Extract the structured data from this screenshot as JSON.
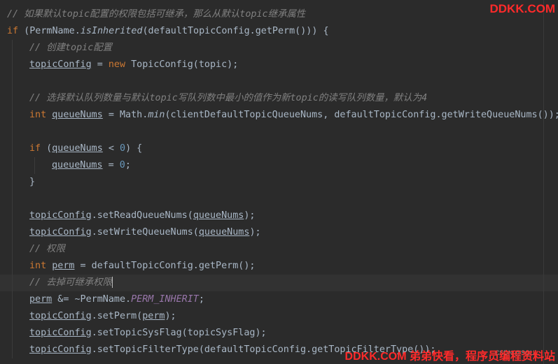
{
  "code": {
    "lines": [
      {
        "indent": 0,
        "tokens": [
          {
            "t": "// 如果默认topic配置的权限包括可继承，那么从默认topic继承属性",
            "c": "comment"
          }
        ]
      },
      {
        "indent": 0,
        "tokens": [
          {
            "t": "if",
            "c": "keyword"
          },
          {
            "t": " (PermName."
          },
          {
            "t": "isInherited",
            "c": "italic"
          },
          {
            "t": "(defaultTopicConfig.getPerm())) {"
          }
        ]
      },
      {
        "indent": 1,
        "tokens": [
          {
            "t": "// 创建topic配置",
            "c": "comment"
          }
        ]
      },
      {
        "indent": 1,
        "tokens": [
          {
            "t": "topicConfig",
            "c": "u"
          },
          {
            "t": " = "
          },
          {
            "t": "new",
            "c": "keyword"
          },
          {
            "t": " TopicConfig(topic);"
          }
        ]
      },
      {
        "indent": 1,
        "tokens": []
      },
      {
        "indent": 1,
        "tokens": [
          {
            "t": "// 选择默认队列数量与默认topic写队列数中最小的值作为新topic的读写队列数量，默认为4",
            "c": "comment"
          }
        ]
      },
      {
        "indent": 1,
        "tokens": [
          {
            "t": "int",
            "c": "keyword"
          },
          {
            "t": " "
          },
          {
            "t": "queueNums",
            "c": "u"
          },
          {
            "t": " = Math."
          },
          {
            "t": "min",
            "c": "italic"
          },
          {
            "t": "(clientDefaultTopicQueueNums, defaultTopicConfig.getWriteQueueNums());"
          }
        ]
      },
      {
        "indent": 1,
        "tokens": []
      },
      {
        "indent": 1,
        "tokens": [
          {
            "t": "if",
            "c": "keyword"
          },
          {
            "t": " ("
          },
          {
            "t": "queueNums",
            "c": "u"
          },
          {
            "t": " < "
          },
          {
            "t": "0",
            "c": "num"
          },
          {
            "t": ") {"
          }
        ]
      },
      {
        "indent": 2,
        "tokens": [
          {
            "t": "queueNums",
            "c": "u"
          },
          {
            "t": " = "
          },
          {
            "t": "0",
            "c": "num"
          },
          {
            "t": ";"
          }
        ]
      },
      {
        "indent": 1,
        "tokens": [
          {
            "t": "}"
          }
        ]
      },
      {
        "indent": 1,
        "tokens": []
      },
      {
        "indent": 1,
        "tokens": [
          {
            "t": "topicConfig",
            "c": "u"
          },
          {
            "t": ".setReadQueueNums("
          },
          {
            "t": "queueNums",
            "c": "u"
          },
          {
            "t": ");"
          }
        ]
      },
      {
        "indent": 1,
        "tokens": [
          {
            "t": "topicConfig",
            "c": "u"
          },
          {
            "t": ".setWriteQueueNums("
          },
          {
            "t": "queueNums",
            "c": "u"
          },
          {
            "t": ");"
          }
        ]
      },
      {
        "indent": 1,
        "tokens": [
          {
            "t": "// 权限",
            "c": "comment"
          }
        ]
      },
      {
        "indent": 1,
        "tokens": [
          {
            "t": "int",
            "c": "keyword"
          },
          {
            "t": " "
          },
          {
            "t": "perm",
            "c": "u"
          },
          {
            "t": " = defaultTopicConfig.getPerm();"
          }
        ]
      },
      {
        "indent": 1,
        "current": true,
        "caret": true,
        "tokens": [
          {
            "t": "// 去掉可继承权限",
            "c": "comment"
          }
        ]
      },
      {
        "indent": 1,
        "tokens": [
          {
            "t": "perm",
            "c": "u"
          },
          {
            "t": " &= ~PermName."
          },
          {
            "t": "PERM_INHERIT",
            "c": "const"
          },
          {
            "t": ";"
          }
        ]
      },
      {
        "indent": 1,
        "tokens": [
          {
            "t": "topicConfig",
            "c": "u"
          },
          {
            "t": ".setPerm("
          },
          {
            "t": "perm",
            "c": "u"
          },
          {
            "t": ");"
          }
        ]
      },
      {
        "indent": 1,
        "tokens": [
          {
            "t": "topicConfig",
            "c": "u"
          },
          {
            "t": ".setTopicSysFlag(topicSysFlag);"
          }
        ]
      },
      {
        "indent": 1,
        "tokens": [
          {
            "t": "topicConfig",
            "c": "u"
          },
          {
            "t": ".setTopicFilterType(defaultTopicConfig.getTopicFilterType());"
          }
        ]
      }
    ]
  },
  "colors": {
    "background": "#2b2b2b",
    "text": "#a9b7c6",
    "comment": "#808080",
    "keyword": "#cc7832",
    "number": "#6897bb",
    "constant": "#9876aa",
    "watermark": "#ff2a2a"
  },
  "watermarks": {
    "top": "DDKK.COM",
    "bottom": "DDKK.COM 弟弟快看，程序员编程资料站",
    "csdn": "CSDN @SQU..."
  }
}
